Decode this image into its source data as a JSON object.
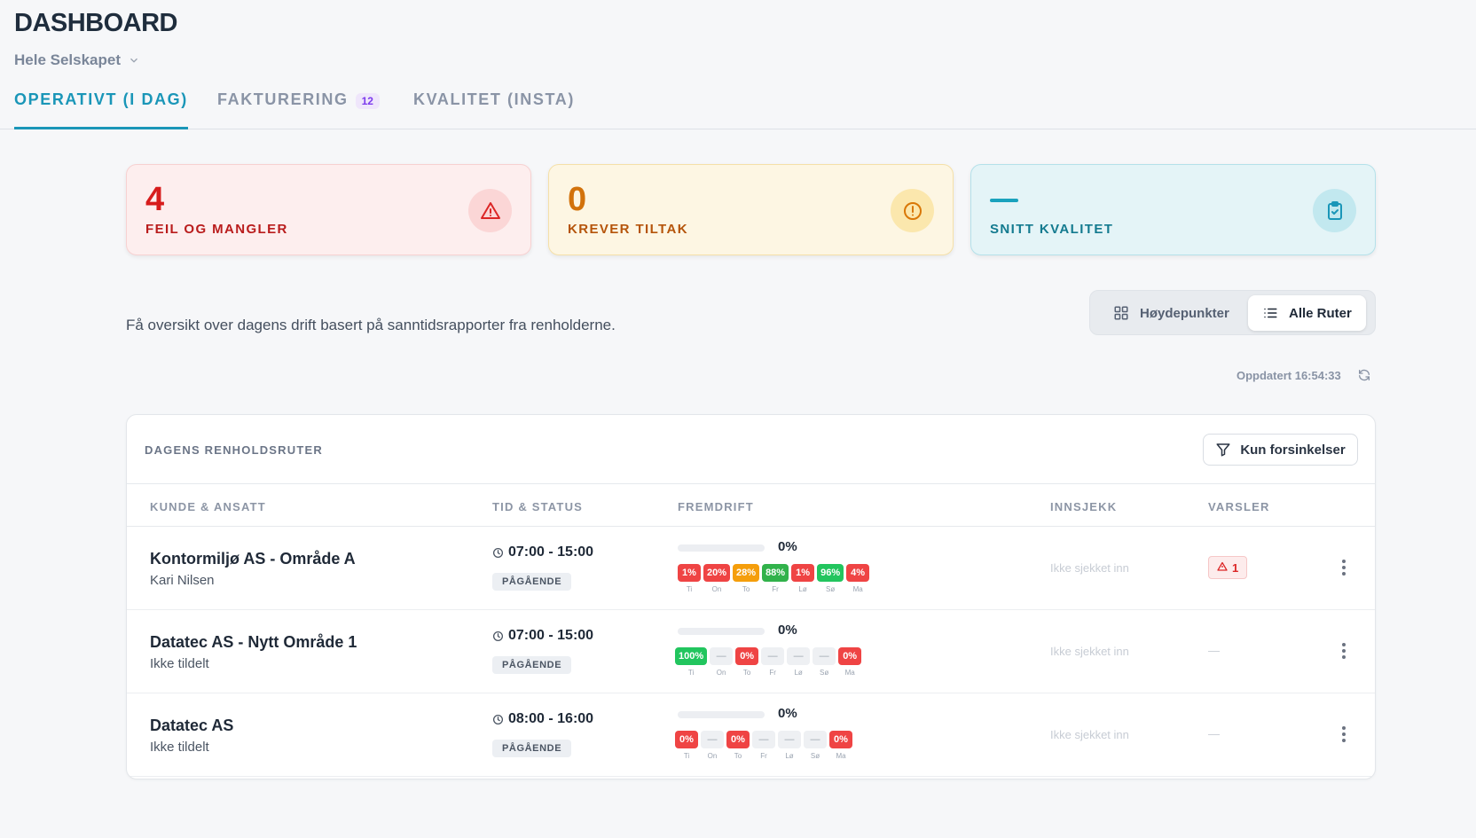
{
  "header": {
    "title": "DASHBOARD",
    "company": "Hele Selskapet"
  },
  "tabs": [
    {
      "label": "OPERATIVT (I DAG)",
      "active": true
    },
    {
      "label": "FAKTURERING",
      "badge": "12"
    },
    {
      "label": "KVALITET (INSTA)"
    }
  ],
  "cards": {
    "errors": {
      "value": "4",
      "label": "FEIL OG MANGLER",
      "icon": "warning-triangle-icon"
    },
    "actions": {
      "value": "0",
      "label": "KREVER TILTAK",
      "icon": "alert-circle-icon"
    },
    "quality": {
      "value": "—",
      "label": "SNITT KVALITET",
      "icon": "clipboard-check-icon"
    }
  },
  "description": "Få oversikt over dagens drift basert på sanntidsrapporter fra renholderne.",
  "view_toggle": {
    "highlights": "Høydepunkter",
    "all_routes": "Alle Ruter",
    "selected": "all_routes"
  },
  "updated": "Oppdatert 16:54:33",
  "routes_panel": {
    "title": "DAGENS RENHOLDSRUTER",
    "filter_label": "Kun forsinkelser",
    "columns": [
      "KUNDE & ANSATT",
      "TID & STATUS",
      "FREMDRIFT",
      "INNSJEKK",
      "VARSLER"
    ],
    "rows": [
      {
        "customer": "Kontormiljø AS - Område A",
        "employee": "Kari Nilsen",
        "time": "07:00 - 15:00",
        "status": "PÅGÅENDE",
        "progress": "0%",
        "progress_value": 0,
        "days": [
          {
            "value": "1%",
            "day": "Ti",
            "color": "red"
          },
          {
            "value": "20%",
            "day": "On",
            "color": "red"
          },
          {
            "value": "28%",
            "day": "To",
            "color": "orange"
          },
          {
            "value": "88%",
            "day": "Fr",
            "color": "green2"
          },
          {
            "value": "1%",
            "day": "Lø",
            "color": "red"
          },
          {
            "value": "96%",
            "day": "Sø",
            "color": "green"
          },
          {
            "value": "4%",
            "day": "Ma",
            "color": "red"
          }
        ],
        "checkin": "Ikke sjekket inn",
        "alert": "1"
      },
      {
        "customer": "Datatec AS - Nytt Område 1",
        "employee": "Ikke tildelt",
        "time": "07:00 - 15:00",
        "status": "PÅGÅENDE",
        "progress": "0%",
        "progress_value": 0,
        "days": [
          {
            "value": "100%",
            "day": "Ti",
            "color": "green"
          },
          {
            "value": "—",
            "day": "On",
            "color": "gray"
          },
          {
            "value": "0%",
            "day": "To",
            "color": "red"
          },
          {
            "value": "—",
            "day": "Fr",
            "color": "gray"
          },
          {
            "value": "—",
            "day": "Lø",
            "color": "gray"
          },
          {
            "value": "—",
            "day": "Sø",
            "color": "gray"
          },
          {
            "value": "0%",
            "day": "Ma",
            "color": "red"
          }
        ],
        "checkin": "Ikke sjekket inn",
        "alert": "—"
      },
      {
        "customer": "Datatec AS",
        "employee": "Ikke tildelt",
        "time": "08:00 - 16:00",
        "status": "PÅGÅENDE",
        "progress": "0%",
        "progress_value": 0,
        "days": [
          {
            "value": "0%",
            "day": "Ti",
            "color": "red"
          },
          {
            "value": "—",
            "day": "On",
            "color": "gray"
          },
          {
            "value": "0%",
            "day": "To",
            "color": "red"
          },
          {
            "value": "—",
            "day": "Fr",
            "color": "gray"
          },
          {
            "value": "—",
            "day": "Lø",
            "color": "gray"
          },
          {
            "value": "—",
            "day": "Sø",
            "color": "gray"
          },
          {
            "value": "0%",
            "day": "Ma",
            "color": "red"
          }
        ],
        "checkin": "Ikke sjekket inn",
        "alert": "—"
      }
    ]
  },
  "colors": {
    "accent": "#1a96b8",
    "error": "#d71c1c",
    "warning": "#d2720b",
    "success": "#22c55e"
  }
}
